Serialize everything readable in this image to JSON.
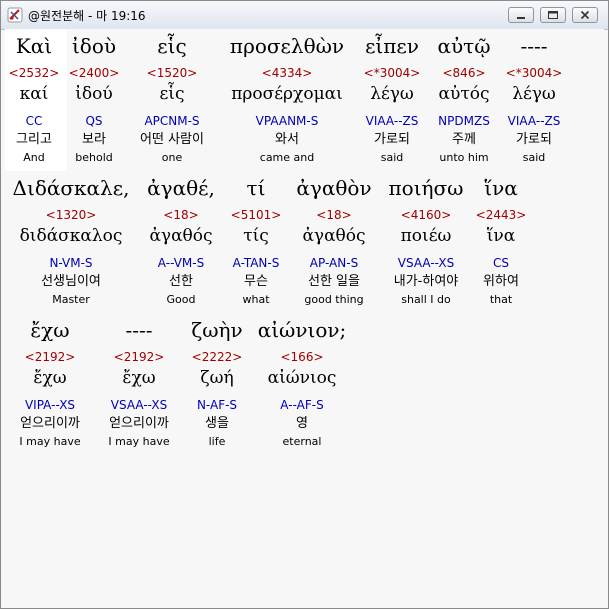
{
  "window": {
    "title": "@원전분해 - 마 19:16"
  },
  "rows": [
    {
      "words": [
        {
          "greek": "Καὶ",
          "strong": "<2532>",
          "lemma": "καί",
          "parse": "CC",
          "korean": "그리고",
          "english": "And"
        },
        {
          "greek": "ἰδοὺ",
          "strong": "<2400>",
          "lemma": "ἰδού",
          "parse": "QS",
          "korean": "보라",
          "english": "behold"
        },
        {
          "greek": "εἷς",
          "strong": "<1520>",
          "lemma": "εἷς",
          "parse": "APCNM-S",
          "korean": "어떤 사람이",
          "english": "one"
        },
        {
          "greek": "προσελθὼν",
          "strong": "<4334>",
          "lemma": "προσέρχομαι",
          "parse": "VPAANM-S",
          "korean": "와서",
          "english": "came and"
        },
        {
          "greek": "εἶπεν",
          "strong": "<*3004>",
          "lemma": "λέγω",
          "parse": "VIAA--ZS",
          "korean": "가로되",
          "english": "said"
        },
        {
          "greek": "αὐτῷ",
          "strong": "<846>",
          "lemma": "αὐτός",
          "parse": "NPDMZS",
          "korean": "주께",
          "english": "unto him"
        },
        {
          "greek": "----",
          "strong": "<*3004>",
          "lemma": "λέγω",
          "parse": "VIAA--ZS",
          "korean": "가로되",
          "english": "said"
        }
      ]
    },
    {
      "words": [
        {
          "greek": "Διδάσκαλε,",
          "strong": "<1320>",
          "lemma": "διδάσκαλος",
          "parse": "N-VM-S",
          "korean": "선생님이여",
          "english": "Master"
        },
        {
          "greek": "ἀγαθέ,",
          "strong": "<18>",
          "lemma": "ἀγαθός",
          "parse": "A--VM-S",
          "korean": "선한",
          "english": "Good"
        },
        {
          "greek": "τί",
          "strong": "<5101>",
          "lemma": "τίς",
          "parse": "A-TAN-S",
          "korean": "무슨",
          "english": "what"
        },
        {
          "greek": "ἀγαθὸν",
          "strong": "<18>",
          "lemma": "ἀγαθός",
          "parse": "AP-AN-S",
          "korean": "선한 일을",
          "english": "good thing"
        },
        {
          "greek": "ποιήσω",
          "strong": "<4160>",
          "lemma": "ποιέω",
          "parse": "VSAA--XS",
          "korean": "내가-하여야",
          "english": "shall I do"
        },
        {
          "greek": "ἵνα",
          "strong": "<2443>",
          "lemma": "ἵνα",
          "parse": "CS",
          "korean": "위하여",
          "english": "that"
        }
      ]
    },
    {
      "words": [
        {
          "greek": "ἔχω",
          "strong": "<2192>",
          "lemma": "ἔχω",
          "parse": "VIPA--XS",
          "korean": "얻으리이까",
          "english": "I may have"
        },
        {
          "greek": "----",
          "strong": "<2192>",
          "lemma": "ἔχω",
          "parse": "VSAA--XS",
          "korean": "얻으리이까",
          "english": "I may have"
        },
        {
          "greek": "ζωὴν",
          "strong": "<2222>",
          "lemma": "ζωή",
          "parse": "N-AF-S",
          "korean": "생을",
          "english": "life"
        },
        {
          "greek": "αἰώνιον;",
          "strong": "<166>",
          "lemma": "αἰώνιος",
          "parse": "A--AF-S",
          "korean": "영",
          "english": "eternal"
        }
      ]
    }
  ]
}
